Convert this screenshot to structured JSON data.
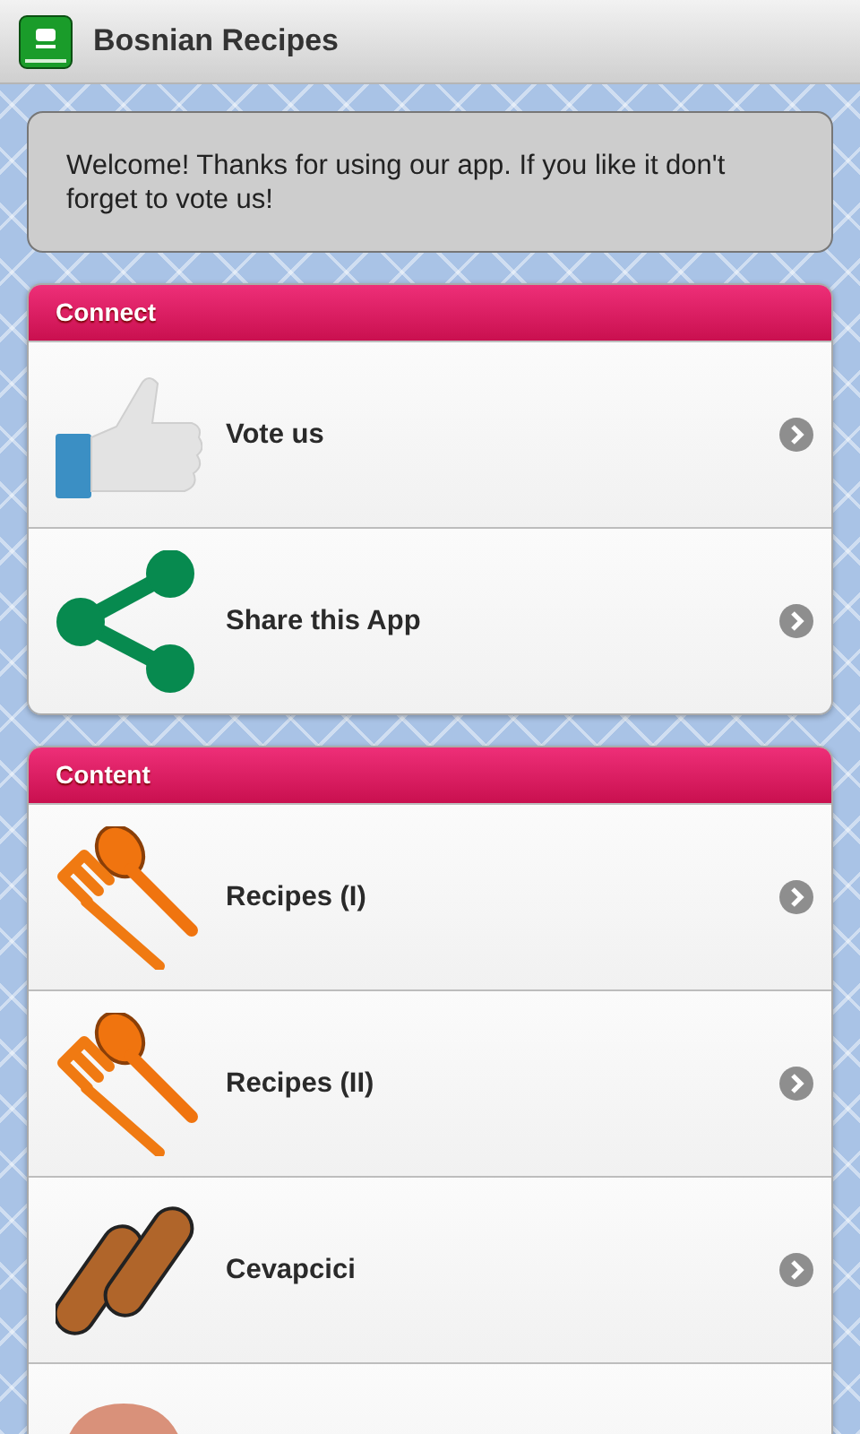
{
  "app_bar": {
    "title": "Bosnian Recipes"
  },
  "welcome": {
    "text": "Welcome! Thanks for using our app. If you like it don't forget to vote us!"
  },
  "sections": [
    {
      "title": "Connect",
      "items": [
        {
          "kind": "thumb",
          "label": "Vote us"
        },
        {
          "kind": "share",
          "label": "Share this App"
        }
      ]
    },
    {
      "title": "Content",
      "items": [
        {
          "kind": "utensils",
          "label": "Recipes (I)"
        },
        {
          "kind": "utensils",
          "label": "Recipes (II)"
        },
        {
          "kind": "sausages",
          "label": "Cevapcici"
        },
        {
          "kind": "head"
        }
      ]
    }
  ]
}
